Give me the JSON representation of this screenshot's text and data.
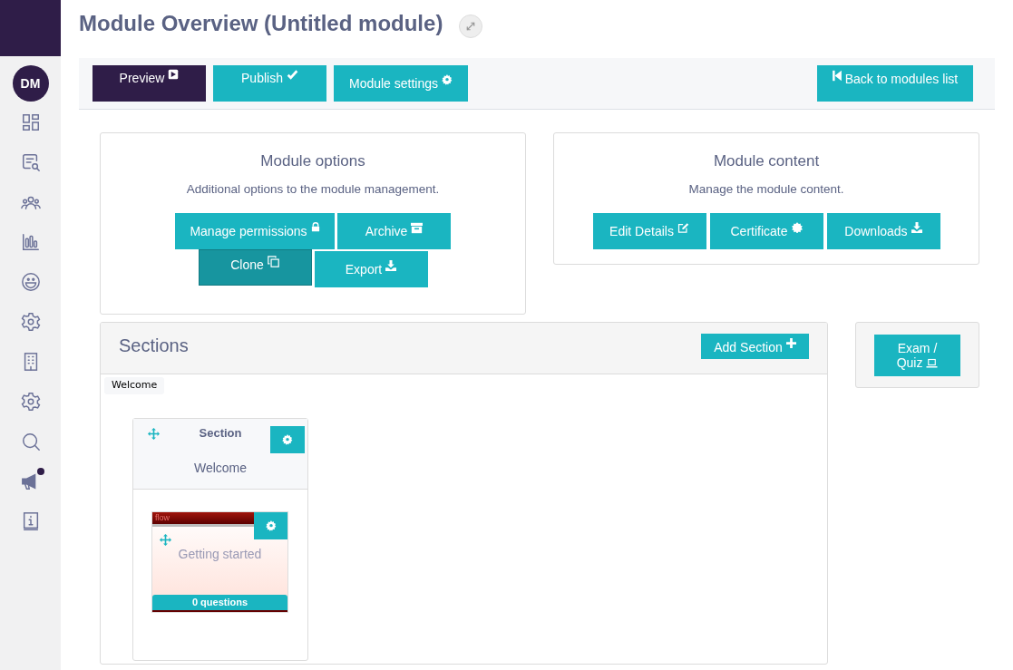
{
  "sidebar": {
    "avatar": "DM",
    "items": [
      {
        "notification": false
      },
      {
        "notification": false
      },
      {
        "notification": false
      },
      {
        "notification": false
      },
      {
        "notification": false
      },
      {
        "notification": false
      },
      {
        "notification": false
      },
      {
        "notification": false
      },
      {
        "notification": false
      },
      {
        "notification": true
      },
      {
        "notification": false
      }
    ]
  },
  "title": "Module Overview (Untitled module)",
  "toolbar": {
    "buttons": [
      {
        "label": "Preview",
        "kind": "dark"
      },
      {
        "label": "Publish",
        "kind": "teal"
      },
      {
        "label": "Module settings",
        "kind": "teal"
      }
    ],
    "back": "Back to modules list"
  },
  "options": {
    "title": "Module options",
    "subtitle": "Additional options to the module management.",
    "rows": [
      [
        {
          "label": "Manage permissions",
          "active": false
        },
        {
          "label": "Archive",
          "active": false
        }
      ],
      [
        {
          "label": "Clone",
          "active": true
        },
        {
          "label": "Export",
          "active": false
        }
      ]
    ]
  },
  "content": {
    "title": "Module content",
    "subtitle": "Manage the module content.",
    "buttons": [
      "Edit Details",
      "Certificate",
      "Downloads"
    ]
  },
  "sections": {
    "title": "Sections",
    "add": "Add Section",
    "tab": "Welcome",
    "section": {
      "heading": "Section",
      "name": "Welcome",
      "item": {
        "logo": "flow",
        "title": "Getting started",
        "count": "0 questions"
      }
    }
  },
  "exam": "Exam / Quiz"
}
